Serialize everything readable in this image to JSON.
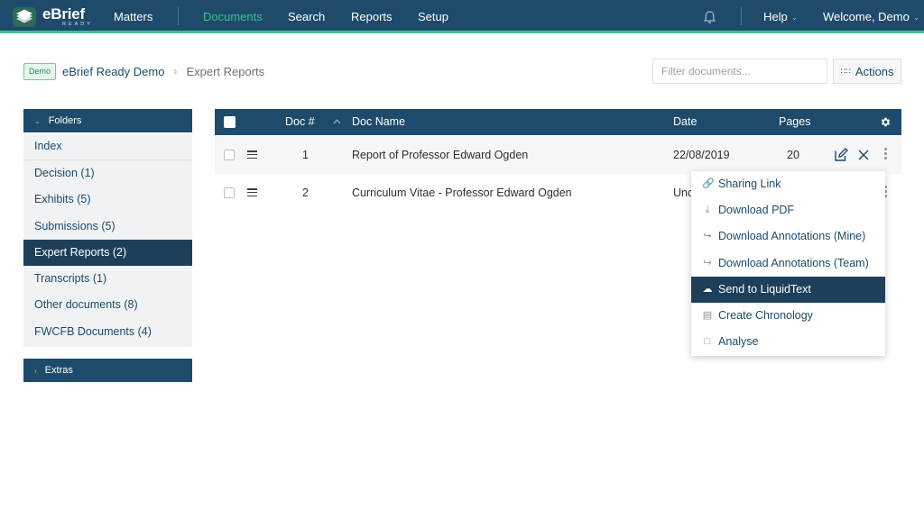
{
  "colors": {
    "primary": "#1e4b6b",
    "accent": "#3cc28e",
    "sidebar_bg": "#f0f2f4",
    "active": "#1e3f5a"
  },
  "logo": {
    "word": "eBrief",
    "sub": "READY"
  },
  "nav": {
    "items": [
      {
        "label": "Matters"
      },
      {
        "label": "Documents"
      },
      {
        "label": "Search"
      },
      {
        "label": "Reports"
      },
      {
        "label": "Setup"
      }
    ],
    "active": "Documents",
    "help_label": "Help",
    "welcome_label": "Welcome, Demo",
    "notification_icon": "bell-icon"
  },
  "breadcrumb": {
    "badge": "Demo",
    "matter": "eBrief Ready Demo",
    "current": "Expert Reports"
  },
  "filter": {
    "placeholder": "Filter documents..."
  },
  "actions_label": "Actions",
  "sidebar": {
    "folders_header": "Folders",
    "items": [
      {
        "label": "Index"
      },
      {
        "label": "Decision (1)"
      },
      {
        "label": "Exhibits (5)"
      },
      {
        "label": "Submissions (5)"
      },
      {
        "label": "Expert Reports (2)"
      },
      {
        "label": "Transcripts (1)"
      },
      {
        "label": "Other documents (8)"
      },
      {
        "label": "FWCFB Documents (4)"
      }
    ],
    "active_item": "Expert Reports (2)",
    "extras_header": "Extras"
  },
  "table": {
    "columns": {
      "doc_no": "Doc #",
      "doc_name": "Doc Name",
      "date": "Date",
      "pages": "Pages"
    },
    "rows": [
      {
        "doc_no": "1",
        "doc_name": "Report of Professor Edward Ogden",
        "date": "22/08/2019",
        "pages": "20"
      },
      {
        "doc_no": "2",
        "doc_name": "Curriculum Vitae - Professor Edward Ogden",
        "date": "Unc",
        "pages": ""
      }
    ]
  },
  "dropdown": {
    "items": [
      {
        "label": "Sharing Link",
        "icon": "link-icon"
      },
      {
        "label": "Download PDF",
        "icon": "download-icon"
      },
      {
        "label": "Download Annotations (Mine)",
        "icon": "export-icon"
      },
      {
        "label": "Download Annotations (Team)",
        "icon": "export-icon"
      },
      {
        "label": "Send to LiquidText",
        "icon": "cloud-upload-icon"
      },
      {
        "label": "Create Chronology",
        "icon": "table-icon"
      },
      {
        "label": "Analyse",
        "icon": "chat-icon"
      }
    ],
    "active_item": "Send to LiquidText"
  }
}
